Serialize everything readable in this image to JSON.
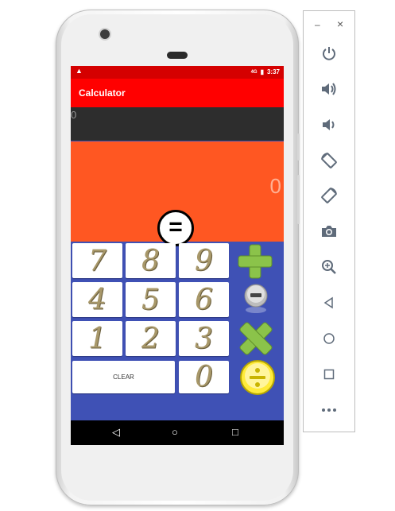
{
  "app": {
    "title": "Calculator"
  },
  "status_bar": {
    "time": "3:37",
    "warning_icon": "warning-icon",
    "signal_label": "4G",
    "battery_label": "▮"
  },
  "display": {
    "expression": "0",
    "result": "0"
  },
  "keypad": {
    "equals": "=",
    "digits": [
      "7",
      "8",
      "9",
      "4",
      "5",
      "6",
      "1",
      "2",
      "3",
      "0"
    ],
    "clear": "CLEAR",
    "operators": [
      "plus-icon",
      "minus-icon",
      "multiply-icon",
      "divide-icon"
    ]
  },
  "nav": {
    "back": "◁",
    "home": "○",
    "recents": "□"
  },
  "emulator_panel": {
    "minimize": "–",
    "close": "×",
    "buttons": [
      "power-icon",
      "volume-up-icon",
      "volume-down-icon",
      "rotate-left-icon",
      "rotate-right-icon",
      "camera-icon",
      "zoom-icon",
      "back-icon",
      "home-icon",
      "overview-icon",
      "more-icon"
    ]
  },
  "colors": {
    "status_bar": "#d50000",
    "app_bar": "#ff0000",
    "expression_bg": "#2d2d2d",
    "result_bg": "#ff5722",
    "keypad_bg": "#3f51b5",
    "plus": "#8bc34a",
    "minus": "#9e9e9e",
    "multiply": "#8bc34a",
    "divide": "#ffeb3b"
  }
}
